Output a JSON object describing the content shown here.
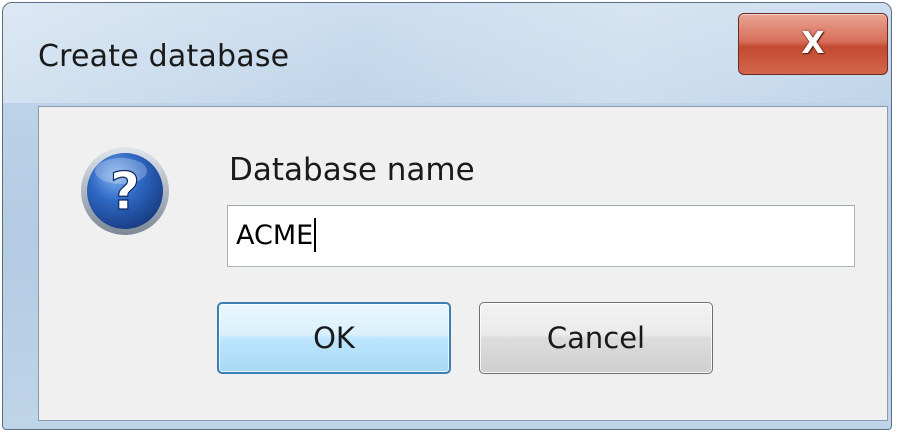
{
  "dialog": {
    "title": "Create database",
    "close_glyph": "X",
    "help_glyph": "?",
    "field_label": "Database name",
    "input_value": "ACME",
    "ok_label": "OK",
    "cancel_label": "Cancel"
  },
  "icons": {
    "close": "close-icon",
    "help": "question-icon"
  },
  "colors": {
    "title_bar": "#bcd2e8",
    "close_button": "#c94f38",
    "ok_button_border": "#3c7fb1",
    "help_icon": "#2a5aa8",
    "client_background": "#f0f0f0"
  }
}
